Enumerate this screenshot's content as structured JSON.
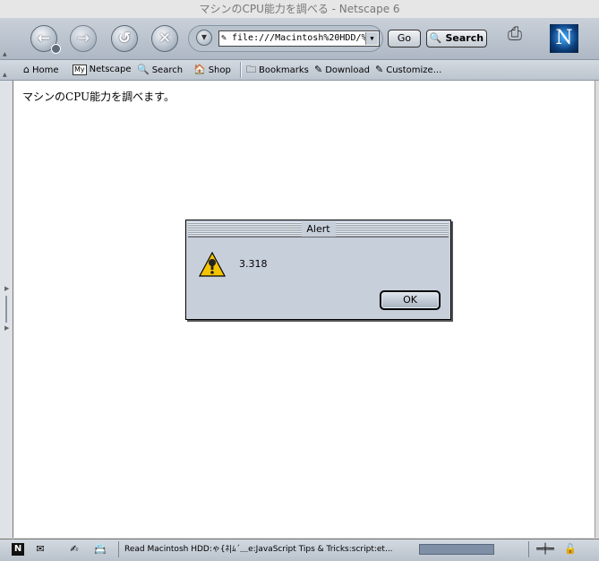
{
  "window": {
    "title": "マシンのCPU能力を調べる - Netscape 6"
  },
  "navigation": {
    "back": "back-arrow-icon",
    "forward": "forward-arrow-icon",
    "reload": "reload-icon",
    "stop": "stop-icon",
    "url_value": "file:///Macintosh%20HDD/%9",
    "go_label": "Go",
    "search_label": "Search"
  },
  "personal_toolbar": {
    "items": [
      {
        "label": "Home",
        "icon": "house-icon"
      },
      {
        "label": "Netscape",
        "icon": "my-netscape-icon",
        "badge": "My"
      },
      {
        "label": "Search",
        "icon": "magnifier-icon"
      },
      {
        "label": "Shop",
        "icon": "shop-icon"
      },
      {
        "label": "Bookmarks",
        "icon": "folder-icon"
      },
      {
        "label": "Download",
        "icon": "bookmark-icon"
      },
      {
        "label": "Customize...",
        "icon": "bookmark-icon"
      }
    ]
  },
  "page": {
    "text": "マシンのCPU能力を調べます。"
  },
  "alert": {
    "title": "Alert",
    "message": "3.318",
    "ok_label": "OK"
  },
  "throbber": {
    "letter": "N"
  },
  "status_bar": {
    "text": "Read Macintosh HDD:ゃ{ﾈ|ﾑ´＿e:JavaScript Tips & Tricks:script:et..."
  },
  "colors": {
    "chrome": "#c7cfdb",
    "progress": "#7f8fa5"
  }
}
